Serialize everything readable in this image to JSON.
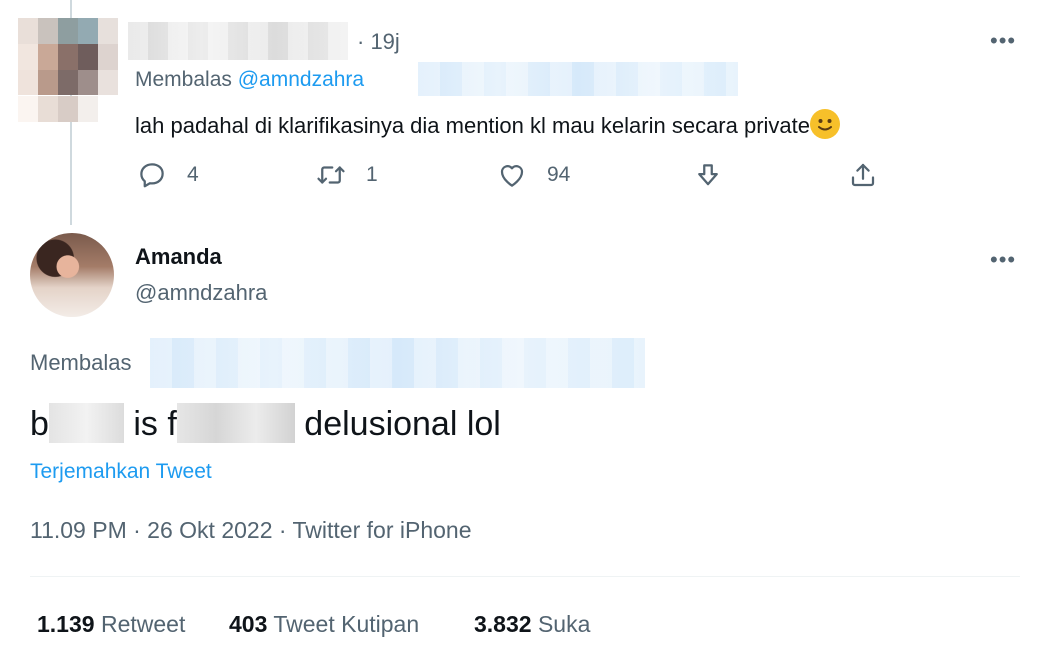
{
  "reply_tweet": {
    "time": "· 19j",
    "replying_prefix": "Membalas",
    "replying_handle": "@amndzahra",
    "text": "lah padahal di klarifikasinya dia mention kl mau kelarin secara private",
    "emoji": "🙂",
    "actions": {
      "replies": "4",
      "retweets": "1",
      "likes": "94"
    }
  },
  "main_tweet": {
    "display_name": "Amanda",
    "handle": "@amndzahra",
    "replying_prefix": "Membalas",
    "text_part1": "b",
    "text_part2": "is f",
    "text_part3": "delusional lol",
    "translate_label": "Terjemahkan Tweet",
    "timestamp": "11.09 PM · 26 Okt 2022 · Twitter for iPhone",
    "stats": [
      {
        "count": "1.139",
        "label": "Retweet"
      },
      {
        "count": "403",
        "label": "Tweet Kutipan"
      },
      {
        "count": "3.832",
        "label": "Suka"
      }
    ]
  },
  "icons": [
    "more-icon",
    "reply-icon",
    "retweet-icon",
    "like-icon",
    "downvote-icon",
    "share-icon"
  ]
}
